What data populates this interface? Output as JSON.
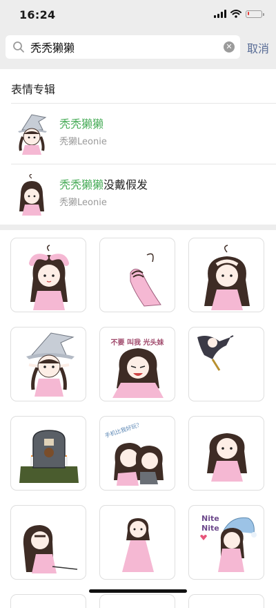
{
  "status": {
    "time": "16:24",
    "battery_level": 0.15,
    "battery_color": "#e53935"
  },
  "search": {
    "query": "秃秃獭獭",
    "cancel_label": "取消"
  },
  "section": {
    "title": "表情专辑"
  },
  "albums": [
    {
      "title_highlight": "秃秃獭獭",
      "title_rest": "",
      "author": "秃獭Leonie",
      "thumb_icon": "witch-girl-sticker"
    },
    {
      "title_highlight": "秃秃獭獭",
      "title_rest": "没戴假发",
      "author": "秃獭Leonie",
      "thumb_icon": "bald-girl-sticker"
    }
  ],
  "stickers": [
    {
      "icon": "girl-covering-head",
      "caption": ""
    },
    {
      "icon": "hand-with-hair-strand",
      "caption": ""
    },
    {
      "icon": "girl-hands-on-head",
      "caption": ""
    },
    {
      "icon": "witch-girl",
      "caption": ""
    },
    {
      "icon": "crying-girl",
      "caption": "不要 叫我 光头妹"
    },
    {
      "icon": "flying-dark-figure",
      "caption": ""
    },
    {
      "icon": "tombstone",
      "caption": ""
    },
    {
      "icon": "two-girls-hugging",
      "caption": "手机比我好玩？"
    },
    {
      "icon": "girl-standing",
      "caption": ""
    },
    {
      "icon": "girl-lying-down",
      "caption": ""
    },
    {
      "icon": "girl-in-dress",
      "caption": ""
    },
    {
      "icon": "girl-nightcap",
      "caption": "Nite Nite"
    }
  ],
  "colors": {
    "highlight": "#4aad5a",
    "link": "#576b95",
    "skin": "#fdeee6",
    "hair": "#3e2c25",
    "dress": "#f5b8d3"
  }
}
